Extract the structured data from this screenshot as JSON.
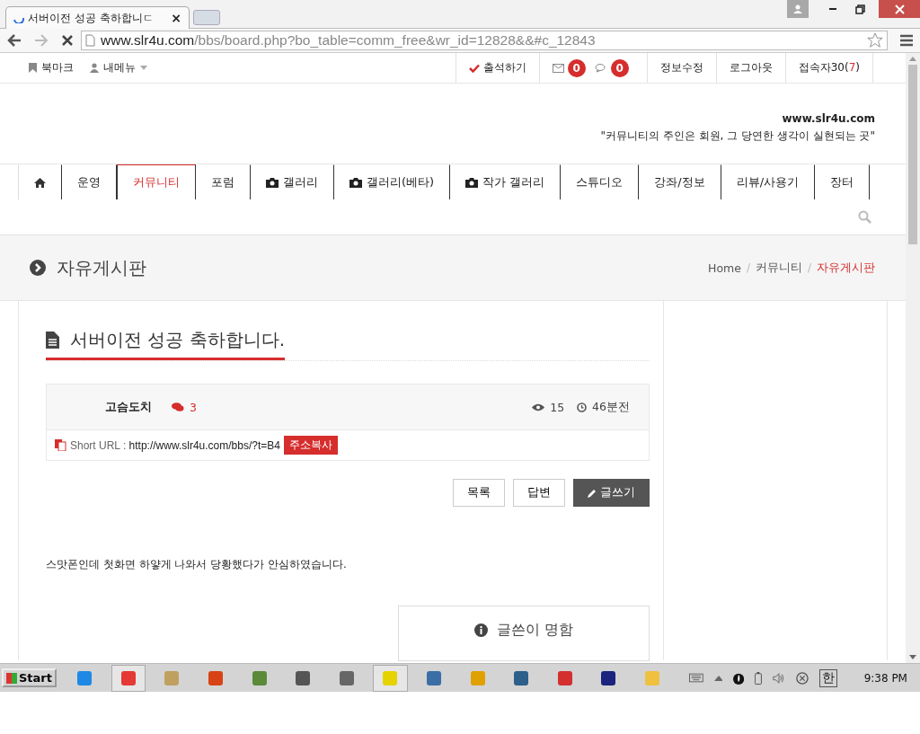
{
  "browser": {
    "tabs": [
      {
        "title": "서버이전 성공 축하합니ㄷ",
        "selected": true,
        "loading": true
      }
    ],
    "close_glyph": "×",
    "url_host": "www.slr4u.com",
    "url_path": "/bbs/board.php?bo_table=comm_free&wr_id=12828&&#c_12843"
  },
  "topbar": {
    "left": [
      {
        "label": "북마크",
        "kind": "bookmark"
      },
      {
        "label": "내메뉴",
        "kind": "user"
      }
    ],
    "right": [
      {
        "label": "출석하기",
        "kind": "check"
      },
      {
        "kind": "badges",
        "badges": [
          {
            "count": "0"
          },
          {
            "count": "0"
          }
        ]
      },
      {
        "label": "정보수정",
        "kind": "plain"
      },
      {
        "label": "로그아웃",
        "kind": "plain"
      },
      {
        "label": "접속자30(",
        "count": "7",
        "tail": ")",
        "kind": "visitors"
      }
    ]
  },
  "header": {
    "site": "www.slr4u.com",
    "slogan": "\"커뮤니티의 주인은 회원, 그 당연한 생각이 실현되는 곳\""
  },
  "nav": [
    {
      "kind": "home",
      "selected": false
    },
    {
      "label": "운영",
      "kind": "text",
      "selected": false
    },
    {
      "label": "커뮤니티",
      "kind": "text",
      "selected": true
    },
    {
      "label": "포럼",
      "kind": "text",
      "selected": false
    },
    {
      "label": "갤러리",
      "kind": "camera",
      "selected": false
    },
    {
      "label": "갤러리(베타)",
      "kind": "camera",
      "selected": false
    },
    {
      "label": "작가 갤러리",
      "kind": "camera",
      "selected": false
    },
    {
      "label": "스튜디오",
      "kind": "text",
      "selected": false
    },
    {
      "label": "강좌/정보",
      "kind": "text",
      "selected": false
    },
    {
      "label": "리뷰/사용기",
      "kind": "text",
      "selected": false
    },
    {
      "label": "장터",
      "kind": "text",
      "selected": false
    }
  ],
  "page_title": "자유게시판",
  "breadcrumb": [
    {
      "label": "Home",
      "current": false,
      "separator": "/"
    },
    {
      "label": "커뮤니티",
      "current": false,
      "separator": "/"
    },
    {
      "label": "자유게시판",
      "current": true
    }
  ],
  "post": {
    "title": "서버이전 성공 축하합니다.",
    "author": "고슴도치",
    "comments": "3",
    "views": "15",
    "time": "46분전",
    "short_url_label": "Short URL : ",
    "short_url": "http://www.slr4u.com/bbs/?t=B4",
    "copy_button": "주소복사",
    "buttons": [
      {
        "label": "목록",
        "kind": "plain"
      },
      {
        "label": "답변",
        "kind": "plain"
      },
      {
        "label": "글쓰기",
        "kind": "primary"
      }
    ],
    "body": "스맛폰인데 첫화면 하얗게 나와서 당황했다가 안심하였습니다.",
    "author_card_title": "글쓴이 명함"
  },
  "taskbar": {
    "start": "Start",
    "apps": [
      {
        "color": "#1e88e5",
        "active": false
      },
      {
        "color": "#e53935",
        "active": true
      },
      {
        "color": "#c0a060",
        "active": false
      },
      {
        "color": "#d84315",
        "active": false
      },
      {
        "color": "#5a8a3a",
        "active": false
      },
      {
        "color": "#555555",
        "active": false
      },
      {
        "color": "#666666",
        "active": false
      },
      {
        "color": "#e6d200",
        "active": true
      },
      {
        "color": "#3a6ea5",
        "active": false
      },
      {
        "color": "#e0a000",
        "active": false
      },
      {
        "color": "#2c5f8a",
        "active": false
      },
      {
        "color": "#d32f2f",
        "active": false
      },
      {
        "color": "#1a237e",
        "active": false
      },
      {
        "color": "#f0c040",
        "active": false
      }
    ],
    "ime": "한",
    "clock": "9:38 PM"
  }
}
